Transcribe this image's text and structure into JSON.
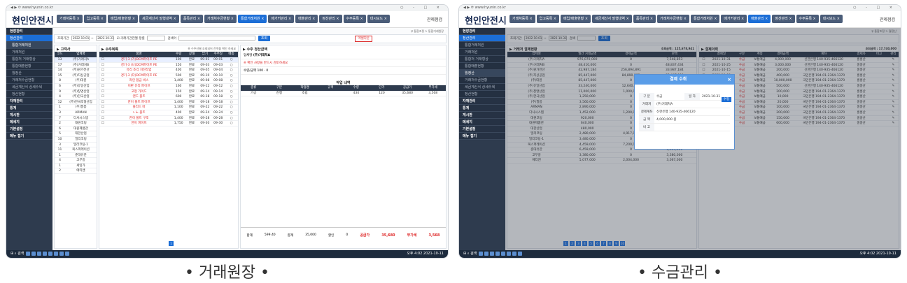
{
  "captions": [
    "• 거래원장 •",
    "• 수금관리 •"
  ],
  "app": {
    "logo": "현인안전시",
    "user": "관제점검",
    "win_controls": "○ - □ ×"
  },
  "s1": {
    "tabs": [
      "거래처등록 ×",
      "입고등록 ×",
      "매입/매출현황 ×",
      "세금계산서 발행내역 ×",
      "품목관리 ×",
      "거래처수금현황 ×",
      "통합거래처원 ×",
      "매거커관리 ×",
      "매출관리 ×",
      "정산관리 ×",
      "수주등록 ×",
      "대시보드 ×"
    ],
    "side": [
      {
        "t": "현장관리",
        "c": "hd"
      },
      {
        "t": "정산관리",
        "c": "on"
      },
      {
        "t": "통합거래처원",
        "c": "sub on"
      },
      {
        "t": "거래처원",
        "c": "sub"
      },
      {
        "t": "통합처 거래형상",
        "c": "sub"
      },
      {
        "t": "통합매출현황",
        "c": "sub"
      },
      {
        "t": "월정산",
        "c": "sub"
      },
      {
        "t": "거래처수금현황",
        "c": "sub"
      },
      {
        "t": "세금계산서 상세수색",
        "c": "sub"
      },
      {
        "t": "정산현황",
        "c": "sub"
      },
      {
        "t": "자재관리",
        "c": "hd"
      },
      {
        "t": "통계",
        "c": "hd"
      },
      {
        "t": "게시판",
        "c": "hd"
      },
      {
        "t": "메세지",
        "c": "hd"
      },
      {
        "t": "기본설정",
        "c": "hd"
      },
      {
        "t": "메뉴 접기",
        "c": "hd"
      }
    ],
    "breadcrumb": "♀ 통합조정 > 통합거래원장",
    "filter": {
      "label": "조회기간",
      "from": "2022-10-01",
      "to": "2022-10-31",
      "chk": "거래기간전월",
      "sort": "정렬",
      "kw": "검색어",
      "search": "조회",
      "excel": "엑셀다운"
    },
    "left": {
      "title": "▶ 고객사",
      "cols": [
        "코드",
        "업체명"
      ],
      "rows": [
        [
          "13",
          "(주)거래처A"
        ],
        [
          "17",
          "(주)거래처B"
        ],
        [
          "14",
          "(주)원가전산"
        ],
        [
          "15",
          "(주)지상공업"
        ],
        [
          "8",
          "(주)대원"
        ],
        [
          "6",
          "(주)유일산업"
        ],
        [
          "9",
          "(주)창명산업"
        ],
        [
          "4",
          "(주)한국산업"
        ],
        [
          "12",
          "(주)한국조형산업"
        ],
        [
          "1",
          "(주)필름"
        ],
        [
          "3",
          "ARMAN"
        ],
        [
          "7",
          "다사시스템"
        ],
        [
          "2",
          "대원코팅"
        ],
        [
          "6",
          "대원제품관"
        ],
        [
          "5",
          "대한산업"
        ],
        [
          "10",
          "밀리코팅"
        ],
        [
          "3",
          "밀리코팅-1"
        ],
        [
          "11",
          "복스퍼레이션"
        ],
        [
          "1",
          "준대유한"
        ],
        [
          "4",
          "고무흥"
        ],
        [
          "1",
          "세잉가"
        ],
        [
          "2",
          "에티앤"
        ]
      ]
    },
    "mid": {
      "title": "▶ 수주목록",
      "note": "※ 수주선별 조회되어 잔액을 확인 하세요",
      "cols": [
        "",
        "품명",
        "수량",
        "상태",
        "납기",
        "수주일",
        "배송"
      ],
      "rows": [
        [
          "☐",
          "경기-3 (가)DCM파이프 PE",
          "100",
          "완료",
          "09-01",
          "09-01",
          "○"
        ],
        [
          "☐",
          "경기-3 (나)DCM파이프 PE",
          "150",
          "완료",
          "09-03",
          "09-03",
          "○"
        ],
        [
          "☐",
          "유리 조각 지진작업",
          "400",
          "완료",
          "09-05",
          "09-04",
          "○"
        ],
        [
          "☐",
          "경기-3 (다)DCM파이프 PE",
          "500",
          "완료",
          "09-10",
          "09-10",
          "○"
        ],
        [
          "☐",
          "라인 합금 비스",
          "1,400",
          "완료",
          "09-08",
          "09-08",
          "○"
        ],
        [
          "☐",
          "이판 유리 파이프",
          "160",
          "완료",
          "09-12",
          "09-12",
          "○"
        ],
        [
          "☐",
          "고정 가이드",
          "150",
          "완료",
          "09-14",
          "09-14",
          "○"
        ],
        [
          "☐",
          "엔드 볼트",
          "600",
          "완료",
          "09-18",
          "09-18",
          "○"
        ],
        [
          "☐",
          "한이 볼트 파이프",
          "1,400",
          "완료",
          "09-18",
          "09-18",
          "○"
        ],
        [
          "☐",
          "블리드 바",
          "1,100",
          "완료",
          "09-22",
          "09-22",
          "○"
        ],
        [
          "☐",
          "ㄴ노 볼트",
          "400",
          "완료",
          "09-24",
          "09-24",
          "○"
        ],
        [
          "☐",
          "한이 볼트 구조",
          "1,400",
          "완료",
          "09-28",
          "09-28",
          "○"
        ],
        [
          "☐",
          "한이 파이프",
          "1,750",
          "완료",
          "09-30",
          "09-30",
          "○"
        ]
      ]
    },
    "right": {
      "title": "▶ 수주 정산금액",
      "co": "(주)거래처A",
      "ok": "확정",
      "c1": "업체명",
      "c2": "등록",
      "c3": "담당",
      "warn": "※ 확인 사항을 반드시 검토하세요",
      "q": "수량/금액",
      "vals": [
        "100",
        "0"
      ],
      "dtitle": "작업 내역",
      "dcols": [
        "종류",
        "구분",
        "작업명",
        "규격",
        "수량",
        "단가",
        "공급가",
        "부가세"
      ],
      "drow": [
        "가공",
        "진행",
        "조립",
        "",
        "434",
        "120",
        "35,680",
        "3,568"
      ],
      "sum": [
        "합계",
        "599.40",
        "합계",
        "35,000",
        "할인",
        "0",
        "공급가",
        "35,680",
        "부가세",
        "3,568"
      ]
    }
  },
  "s2": {
    "tabs": [
      "거래처등록 ×",
      "입고등록 ×",
      "매입/매출현황 ×",
      "세금계산서 발행내역 ×",
      "품목관리 ×",
      "거래처수금현황 ×",
      "통합거래처원 ×",
      "매거커관리 ×",
      "매출관리 ×",
      "정산관리 ×",
      "수주등록 ×",
      "대시보드 ×"
    ],
    "side": [
      {
        "t": "현장관리",
        "c": "hd"
      },
      {
        "t": "정산관리",
        "c": "on"
      },
      {
        "t": "통합거래처원",
        "c": "sub"
      },
      {
        "t": "거래처원",
        "c": "sub"
      },
      {
        "t": "통합처 거래형상",
        "c": "sub"
      },
      {
        "t": "통합매출현황",
        "c": "sub"
      },
      {
        "t": "월정산",
        "c": "sub on"
      },
      {
        "t": "거래처수금현황",
        "c": "sub"
      },
      {
        "t": "세금계산서 상세수색",
        "c": "sub"
      },
      {
        "t": "정산현황",
        "c": "sub"
      },
      {
        "t": "자재관리",
        "c": "hd"
      },
      {
        "t": "통계",
        "c": "hd"
      },
      {
        "t": "게시판",
        "c": "hd"
      },
      {
        "t": "메세지",
        "c": "hd"
      },
      {
        "t": "기본설정",
        "c": "hd"
      },
      {
        "t": "메뉴 접기",
        "c": "hd"
      }
    ],
    "breadcrumb": "♀ 통합조정 > 월정산",
    "filter": {
      "label": "조회기간",
      "from": "2022-10-01",
      "to": "2022-10-31",
      "kw": "검색",
      "search": "조회"
    },
    "left": {
      "title": "▶ 거래처 결제현황",
      "total": "조회금액 : 125,678,941",
      "cols": [
        "업체명",
        "월간 거래금액",
        "결제금액",
        "잔액"
      ],
      "rows": [
        [
          "(주)거래처A",
          "976,070,000",
          "0",
          "7,548,853"
        ],
        [
          "(주)거래처B",
          "48,410,000",
          "0",
          "48,837,434"
        ],
        [
          "(주)원가전산",
          "42,987,184",
          "256,894,891",
          "33,987,184"
        ],
        [
          "(주)지상공업",
          "85,447,000",
          "84,890,888",
          "85,447,000"
        ],
        [
          "(주)대원",
          "85,447,000",
          "0",
          "85,447,000"
        ],
        [
          "(주)유일산업",
          "33,240,000",
          "12,640,000",
          "11,847,000"
        ],
        [
          "(주)창명산업",
          "11,000,000",
          "1,000,000",
          "10,000,000"
        ],
        [
          "(주)한국산업",
          "1,250,000",
          "0",
          "1,250,000"
        ],
        [
          "(주)필름",
          "3,560,000",
          "0",
          "3,560,000"
        ],
        [
          "ARMAN",
          "2,890,000",
          "0",
          "2,890,000"
        ],
        [
          "다사시스템",
          "1,452,000",
          "1,200,000",
          "252,000"
        ],
        [
          "대원코팅",
          "920,000",
          "0",
          "920,000"
        ],
        [
          "대원제품관",
          "640,000",
          "0",
          "640,000"
        ],
        [
          "대한산업",
          "480,000",
          "0",
          "480,000"
        ],
        [
          "밀리코팅",
          "2,480,000",
          "4,917,000",
          "2,318,736"
        ],
        [
          "밀리코팅-1",
          "3,480,000",
          "0",
          "3,680,747"
        ],
        [
          "복스퍼레이션",
          "4,459,000",
          "7,200,000",
          "560,000"
        ],
        [
          "준대유한",
          "6,459,000",
          "0",
          "6,459,000"
        ],
        [
          "고무흥",
          "3,380,000",
          "0",
          "3,380,000"
        ],
        [
          "에티앤",
          "5,077,000",
          "2,004,000",
          "3,067,000"
        ]
      ]
    },
    "right": {
      "title": "▶ 결제이력",
      "total": "조회금액 : 17,740,000",
      "cols": [
        "",
        "결제일",
        "구분",
        "계정",
        "결제금액",
        "계좌",
        "결제자",
        "비고",
        "관리"
      ],
      "rows": [
        [
          "☐",
          "2021-10-31",
          "수금",
          "보통예금",
          "4,000,000",
          "신한은행 140-935-466120",
          "홍홍산",
          "",
          "✎"
        ],
        [
          "☐",
          "2021-10-25",
          "수금",
          "보통예금",
          "3,000,000",
          "신한은행 140-935-466120",
          "홍홍산",
          "",
          "✎"
        ],
        [
          "☐",
          "2021-10-15",
          "수금",
          "보통예금",
          "200,000",
          "신한은행 140-935-466120",
          "홍홍산",
          "",
          "✎"
        ],
        [
          "☐",
          "2021-10-08",
          "수금",
          "보통예금",
          "400,000",
          "국민은행 194-01-2364-1370",
          "홍홍산",
          "",
          "✎"
        ],
        [
          "☐",
          "2021-10-05",
          "수금",
          "보통예금",
          "10,000,000",
          "국민은행 194-01-2364-1370",
          "홍홍산",
          "",
          "✎"
        ],
        [
          "☐",
          "2021-09-30",
          "수금",
          "보통예금",
          "500,000",
          "신한은행 140-935-466120",
          "홍홍산",
          "",
          "✎"
        ],
        [
          "☐",
          "2021-09-25",
          "수금",
          "보통예금",
          "200,000",
          "국민은행 194-01-2364-1370",
          "홍홍산",
          "",
          "✎"
        ],
        [
          "☐",
          "2021-09-18",
          "수금",
          "보통예금",
          "10,000",
          "국민은행 194-01-2364-1370",
          "홍홍산",
          "",
          "✎"
        ],
        [
          "☐",
          "2021-09-12",
          "수금",
          "보통예금",
          "20,000",
          "국민은행 194-01-2364-1370",
          "홍홍산",
          "",
          "✎"
        ],
        [
          "☐",
          "2021-09-05",
          "수금",
          "보통예금",
          "100,000",
          "국민은행 194-01-2364-1370",
          "홍홍산",
          "",
          "✎"
        ],
        [
          "☐",
          "2021-08-30",
          "수금",
          "보통예금",
          "200,000",
          "국민은행 194-01-2364-1370",
          "홍홍산",
          "",
          "✎"
        ],
        [
          "☐",
          "2021-08-20",
          "수금",
          "보통예금",
          "150,000",
          "국민은행 194-01-2364-1370",
          "홍홍산",
          "",
          "✎"
        ],
        [
          "☐",
          "2021-08-15",
          "수금",
          "보통예금",
          "600,000",
          "국민은행 194-01-2364-1370",
          "홍홍산",
          "",
          "✎"
        ]
      ]
    },
    "modal": {
      "title": "결제 수취",
      "close": "×",
      "save": "수정",
      "rows": [
        [
          "구 분",
          "수금",
          "일 자",
          "2021-10-31"
        ],
        [
          "거래처",
          "(주)거래처A",
          "",
          ""
        ],
        [
          "결제계좌",
          "신한은행 140-935-466120",
          "",
          ""
        ],
        [
          "금 액",
          "4,000,000 원",
          "",
          ""
        ],
        [
          "비 고",
          "",
          "",
          ""
        ]
      ]
    }
  },
  "taskbar": {
    "search": "검색",
    "clock": "오후 4:02 2021-10-11"
  }
}
